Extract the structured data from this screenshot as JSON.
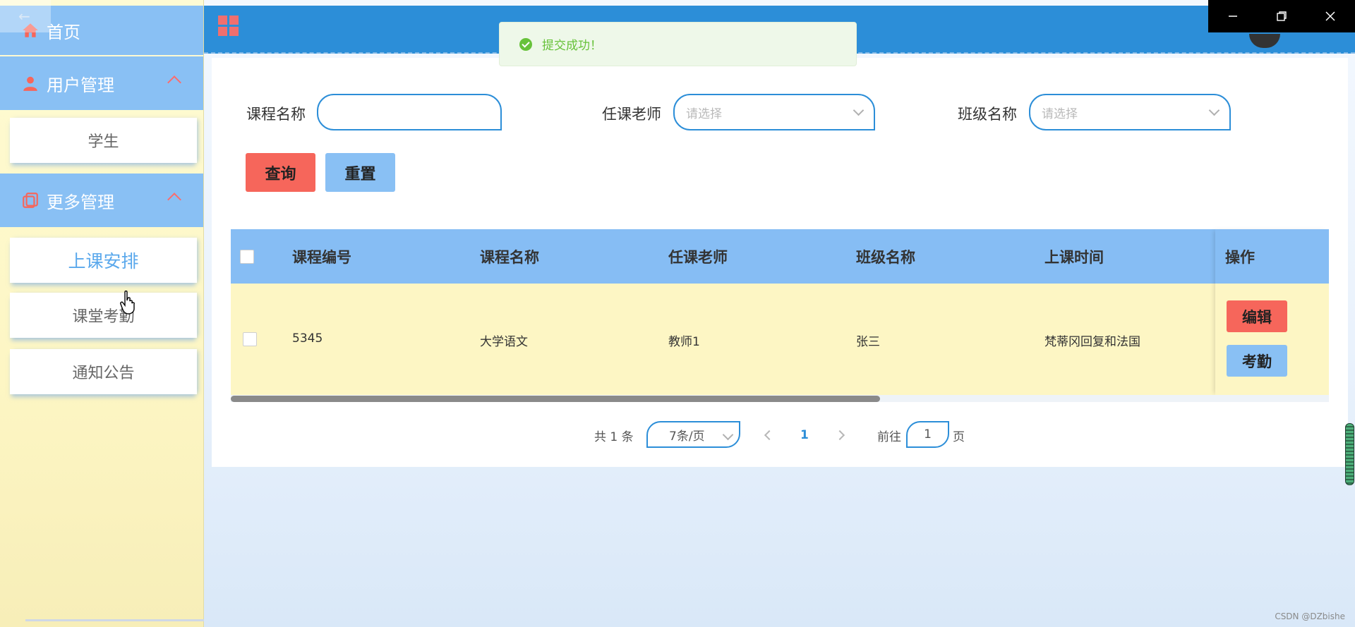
{
  "sidebar": {
    "home_label": "首页",
    "groups": [
      {
        "label": "用户管理",
        "items": [
          {
            "label": "学生"
          }
        ]
      },
      {
        "label": "更多管理",
        "items": [
          {
            "label": "上课安排"
          },
          {
            "label": "课堂考勤"
          },
          {
            "label": "通知公告"
          }
        ]
      }
    ],
    "active_item": "上课安排"
  },
  "toast": {
    "message": "提交成功！",
    "type": "success"
  },
  "filters": {
    "course_name": {
      "label": "课程名称",
      "value": ""
    },
    "teacher": {
      "label": "任课老师",
      "placeholder": "请选择"
    },
    "class_name": {
      "label": "班级名称",
      "placeholder": "请选择"
    }
  },
  "buttons": {
    "query": "查询",
    "reset": "重置"
  },
  "table": {
    "columns": [
      "课程编号",
      "课程名称",
      "任课老师",
      "班级名称",
      "上课时间",
      "操作"
    ],
    "rows": [
      {
        "course_no": "5345",
        "course_name": "大学语文",
        "teacher": "教师1",
        "class_name": "张三",
        "time": "梵蒂冈回复和法国",
        "edit": "编辑",
        "attendance": "考勤"
      }
    ]
  },
  "pagination": {
    "total_text": "共 1 条",
    "page_size": "7条/页",
    "current_page": "1",
    "goto_prefix": "前往",
    "goto_value": "1",
    "goto_suffix": "页"
  },
  "watermark": "CSDN @DZbishe",
  "colors": {
    "accent": "#2c8ed8",
    "sidebar_header": "#89c0f4",
    "danger": "#f6665b",
    "row_bg": "#fdf6c4"
  }
}
